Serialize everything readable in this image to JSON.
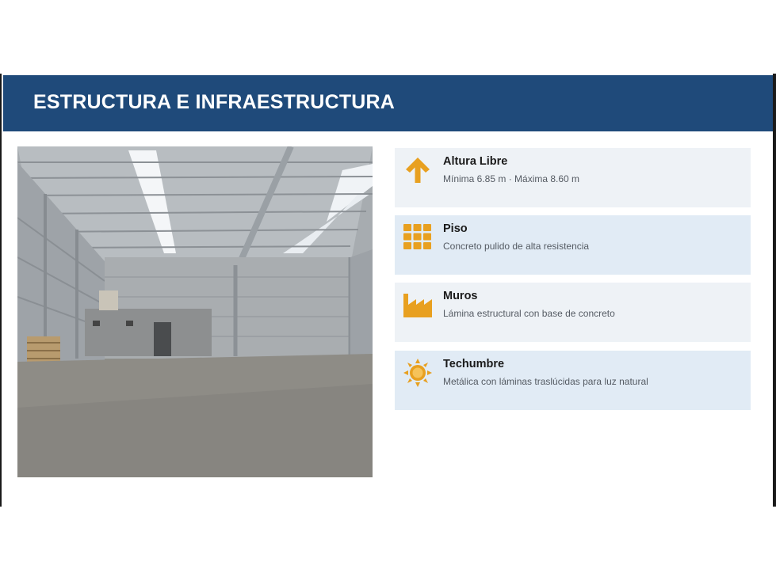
{
  "header": {
    "title": "ESTRUCTURA E INFRAESTRUCTURA"
  },
  "photo": {
    "icon": "warehouse-photo"
  },
  "features": [
    {
      "title": "Altura Libre",
      "desc": "Mínima 6.85 m · Máxima 8.60 m",
      "icon": "arrow-up-icon"
    },
    {
      "title": "Piso",
      "desc": "Concreto pulido de alta resistencia",
      "icon": "grid-icon"
    },
    {
      "title": "Muros",
      "desc": "Lámina estructural con base de concreto",
      "icon": "factory-icon"
    },
    {
      "title": "Techumbre",
      "desc": "Metálica con láminas traslúcidas para luz natural",
      "icon": "sun-icon"
    }
  ],
  "colors": {
    "header_bg": "#1f4a7a",
    "accent": "#e8a020",
    "card_light": "#eef2f6",
    "card_blue": "#e1ebf5"
  }
}
